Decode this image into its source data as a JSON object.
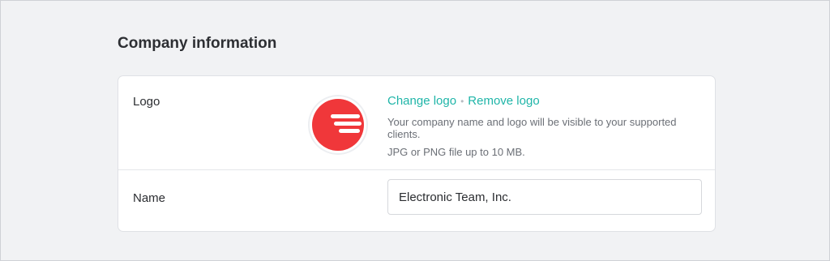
{
  "section": {
    "title": "Company information"
  },
  "logo_row": {
    "label": "Logo",
    "change_logo": "Change logo",
    "separator": "•",
    "remove_logo": "Remove logo",
    "helper_text": "Your company name and logo will be visible to your supported clients.",
    "file_hint": "JPG or PNG file up to 10 MB.",
    "logo_icon": "company-logo-red-circle-stripes",
    "logo_color": "#f0373a"
  },
  "name_row": {
    "label": "Name",
    "value": "Electronic Team, Inc."
  },
  "colors": {
    "accent_link": "#1fb5a8",
    "background": "#f1f2f4",
    "card": "#ffffff"
  }
}
